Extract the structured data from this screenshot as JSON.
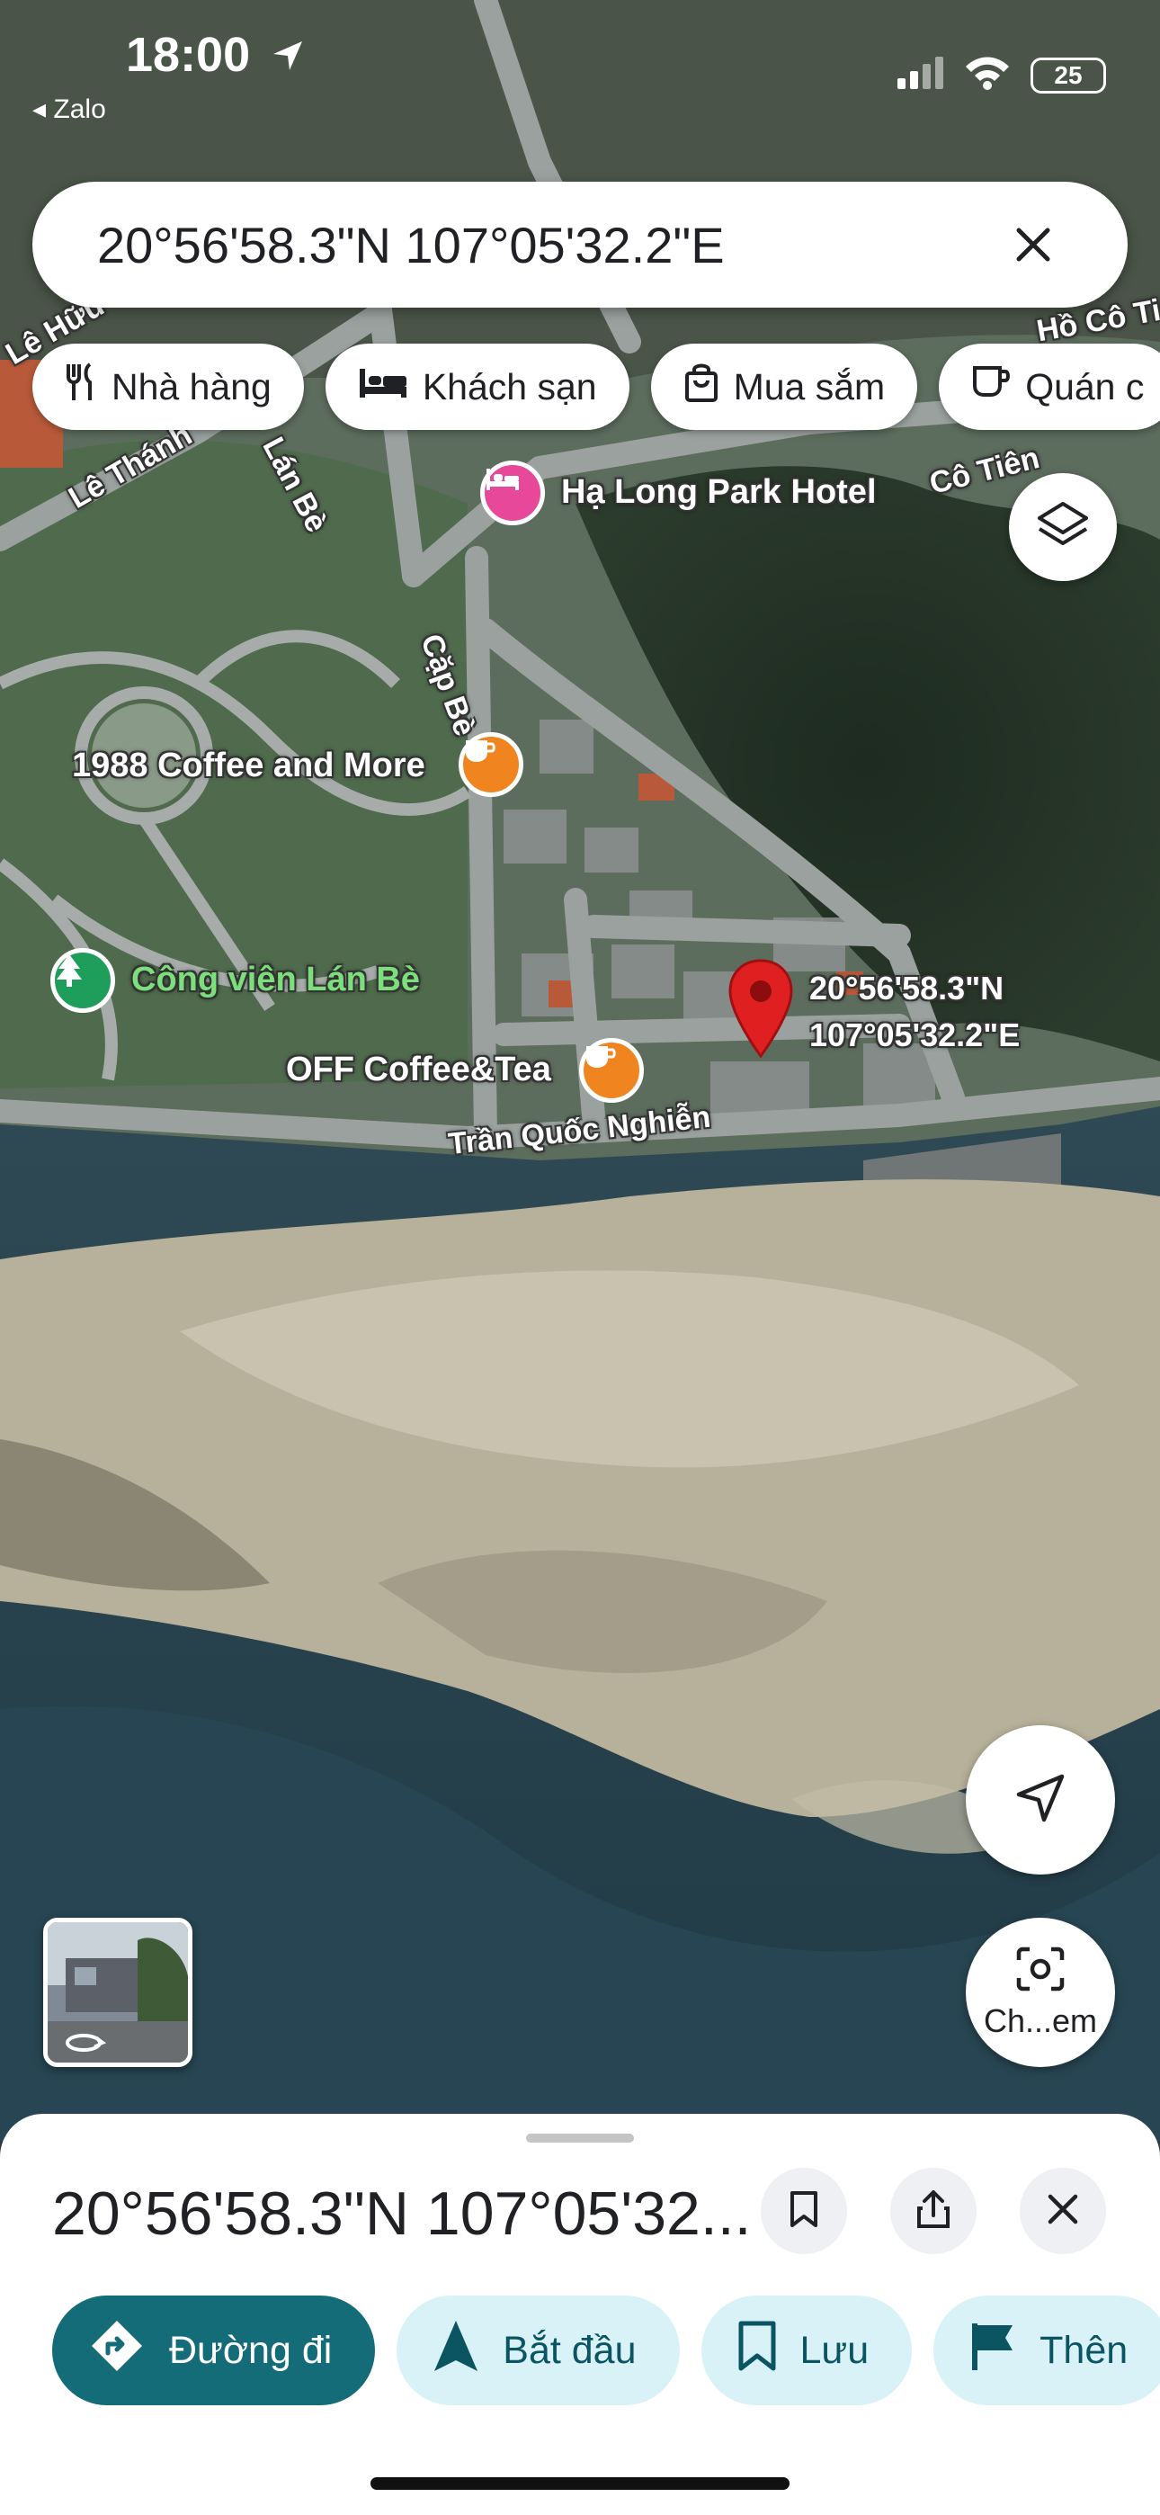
{
  "status_bar": {
    "time": "18:00",
    "back_app": "◂ Zalo",
    "battery": "25"
  },
  "search": {
    "query": "20°56'58.3\"N 107°05'32.2\"E"
  },
  "chips": [
    {
      "label": "Nhà hàng",
      "icon": "utensils-icon"
    },
    {
      "label": "Khách sạn",
      "icon": "bed-icon"
    },
    {
      "label": "Mua sắm",
      "icon": "shopping-bag-icon"
    },
    {
      "label": "Quán c",
      "icon": "coffee-cup-icon"
    }
  ],
  "map": {
    "pois": [
      {
        "name": "Hạ Long Park Hotel",
        "color": "#e8489a",
        "icon": "hotel-icon"
      },
      {
        "name": "1988 Coffee and More",
        "color": "#f0851f",
        "icon": "coffee-icon"
      },
      {
        "name": "OFF Coffee&Tea",
        "color": "#f0851f",
        "icon": "coffee-icon"
      }
    ],
    "park": "Công viên Lán Bè",
    "streets": {
      "tran_quoc_nghien": "Trần Quốc Nghiễn",
      "cap_be": "Cặp Bè",
      "lan_be": "Lán Bè",
      "le_thanh": "Lê Thánh",
      "le_huu": "Lê Hữu",
      "co_tien": "Cô Tiên",
      "ho_co_tien": "Hồ Cô Tiê"
    },
    "pin": {
      "line1": "20°56'58.3\"N",
      "line2": "107°05'32.2\"E",
      "color": "#e02020"
    }
  },
  "controls": {
    "camera_label": "Ch...em"
  },
  "sheet": {
    "title": "20°56'58.3\"N 107°05'32...",
    "actions": [
      {
        "label": "Đường đi",
        "icon": "directions-icon",
        "style": "primary"
      },
      {
        "label": "Bắt đầu",
        "icon": "navigation-arrow-icon",
        "style": "secondary"
      },
      {
        "label": "Lưu",
        "icon": "bookmark-icon",
        "style": "secondary"
      },
      {
        "label": "Thên",
        "icon": "flag-icon",
        "style": "secondary"
      }
    ]
  },
  "colors": {
    "accent": "#146c78",
    "accent_light": "#d9f2f8"
  }
}
